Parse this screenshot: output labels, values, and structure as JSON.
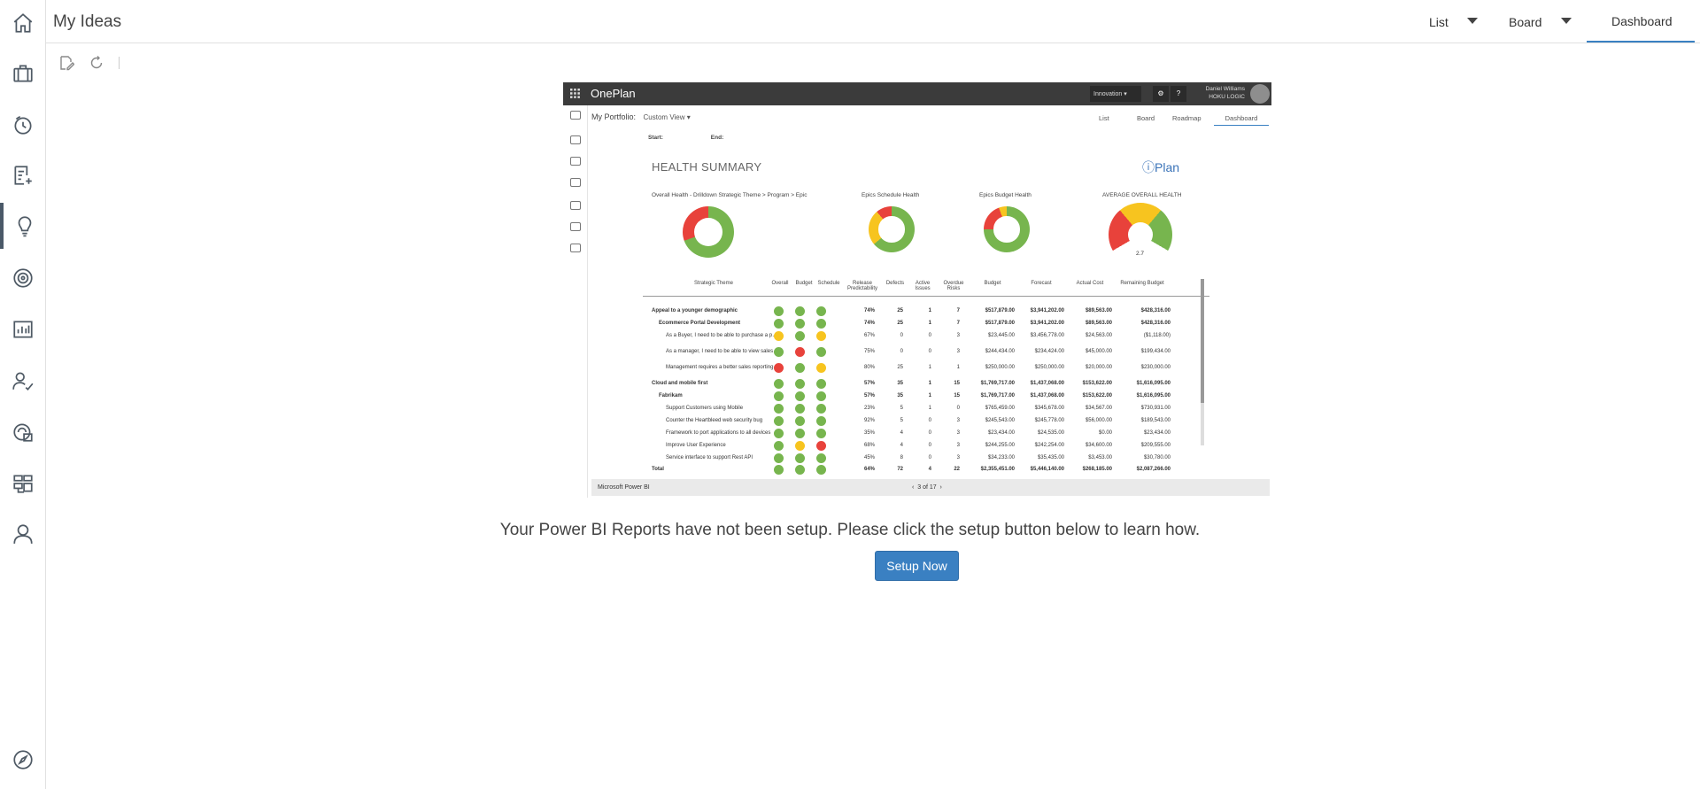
{
  "header": {
    "page_title": "My Ideas",
    "tabs": [
      {
        "label": "List"
      },
      {
        "label": "Board"
      },
      {
        "label": "Dashboard",
        "active": true
      }
    ]
  },
  "sidebar": {
    "items": [
      {
        "icon": "home-icon"
      },
      {
        "icon": "briefcase-icon"
      },
      {
        "icon": "clock-history-icon"
      },
      {
        "icon": "add-list-icon"
      },
      {
        "icon": "lightbulb-icon",
        "active": true
      },
      {
        "icon": "target-icon"
      },
      {
        "icon": "report-chart-icon"
      },
      {
        "icon": "user-check-icon"
      },
      {
        "icon": "resource-icon"
      },
      {
        "icon": "hierarchy-icon"
      },
      {
        "icon": "person-icon"
      },
      {
        "icon": "compass-icon"
      }
    ]
  },
  "toolbar": {
    "icons": [
      "edit-icon",
      "refresh-icon"
    ]
  },
  "preview": {
    "brand": "OnePlan",
    "innovation": "Innovation ▾",
    "user_name": "Daniel Williams",
    "user_org": "HOKU LOGIC",
    "portfolio_label": "My Portfolio:",
    "custom_view": "Custom View ▾",
    "tabs": [
      "List",
      "Board",
      "Roadmap",
      "Dashboard"
    ],
    "start_label": "Start:",
    "end_label": "End:",
    "report_title": "HEALTH SUMMARY",
    "logo_text": "Plan",
    "charts": [
      "Overall Health - Drilldown Strategic Theme > Program > Epic",
      "Epics Schedule Health",
      "Epics Budget Health",
      "AVERAGE OVERALL HEALTH"
    ],
    "gauge_value": "2.7",
    "columns": [
      "Strategic Theme",
      "Overall",
      "Budget",
      "Schedule",
      "Release Predictability",
      "Defects",
      "Active Issues",
      "Overdue Risks",
      "Budget",
      "Forecast",
      "Actual Cost",
      "Remaining Budget"
    ],
    "rows": [
      {
        "name": "Appeal to a younger demographic",
        "bold": true,
        "indent": 0,
        "s": [
          "g",
          "g",
          "g"
        ],
        "vals": [
          "74%",
          "25",
          "1",
          "7",
          "$517,879.00",
          "$3,941,202.00",
          "$89,563.00",
          "$428,316.00"
        ]
      },
      {
        "name": "Ecommerce Portal Development",
        "bold": true,
        "indent": 1,
        "s": [
          "g",
          "g",
          "g"
        ],
        "vals": [
          "74%",
          "25",
          "1",
          "7",
          "$517,879.00",
          "$3,941,202.00",
          "$89,563.00",
          "$428,316.00"
        ]
      },
      {
        "name": "As a Buyer, I need to be able to purchase a product with Pay Pal",
        "bold": false,
        "indent": 2,
        "s": [
          "y",
          "g",
          "y"
        ],
        "vals": [
          "67%",
          "0",
          "0",
          "3",
          "$23,445.00",
          "$3,456,778.00",
          "$24,563.00",
          "($1,118.00)"
        ]
      },
      {
        "name": "As a manager, I need to be able to view sales reports",
        "bold": false,
        "indent": 2,
        "s": [
          "g",
          "r",
          "g"
        ],
        "vals": [
          "75%",
          "0",
          "0",
          "3",
          "$244,434.00",
          "$234,424.00",
          "$45,000.00",
          "$199,434.00"
        ]
      },
      {
        "name": "Management requires a better sales reporting analysis system",
        "bold": false,
        "indent": 2,
        "s": [
          "r",
          "g",
          "y"
        ],
        "vals": [
          "80%",
          "25",
          "1",
          "1",
          "$250,000.00",
          "$250,000.00",
          "$20,000.00",
          "$230,000.00"
        ]
      },
      {
        "name": "Cloud and mobile first",
        "bold": true,
        "indent": 0,
        "s": [
          "g",
          "g",
          "g"
        ],
        "vals": [
          "57%",
          "35",
          "1",
          "15",
          "$1,769,717.00",
          "$1,437,068.00",
          "$153,622.00",
          "$1,616,095.00"
        ]
      },
      {
        "name": "Fabrikam",
        "bold": true,
        "indent": 1,
        "s": [
          "g",
          "g",
          "g"
        ],
        "vals": [
          "57%",
          "35",
          "1",
          "15",
          "$1,769,717.00",
          "$1,437,068.00",
          "$153,622.00",
          "$1,616,095.00"
        ]
      },
      {
        "name": "Support Customers using Mobile",
        "bold": false,
        "indent": 2,
        "s": [
          "g",
          "g",
          "g"
        ],
        "vals": [
          "23%",
          "5",
          "1",
          "0",
          "$765,459.00",
          "$345,678.00",
          "$34,567.00",
          "$730,931.00"
        ]
      },
      {
        "name": "Counter the Heartbleed web security bug",
        "bold": false,
        "indent": 2,
        "s": [
          "g",
          "g",
          "g"
        ],
        "vals": [
          "92%",
          "5",
          "0",
          "3",
          "$245,543.00",
          "$245,778.00",
          "$56,000.00",
          "$189,543.00"
        ]
      },
      {
        "name": "Framework to port applications to all devices",
        "bold": false,
        "indent": 2,
        "s": [
          "g",
          "g",
          "g"
        ],
        "vals": [
          "35%",
          "4",
          "0",
          "3",
          "$23,434.00",
          "$24,535.00",
          "$0.00",
          "$23,434.00"
        ]
      },
      {
        "name": "Improve User Experience",
        "bold": false,
        "indent": 2,
        "s": [
          "g",
          "y",
          "r"
        ],
        "vals": [
          "68%",
          "4",
          "0",
          "3",
          "$244,255.00",
          "$242,254.00",
          "$34,600.00",
          "$209,555.00"
        ]
      },
      {
        "name": "Service interface to support Rest API",
        "bold": false,
        "indent": 2,
        "s": [
          "g",
          "g",
          "g"
        ],
        "vals": [
          "45%",
          "8",
          "0",
          "3",
          "$34,233.00",
          "$35,435.00",
          "$3,453.00",
          "$30,780.00"
        ]
      },
      {
        "name": "Total",
        "bold": true,
        "indent": 0,
        "s": [
          "g",
          "g",
          "g"
        ],
        "vals": [
          "64%",
          "72",
          "4",
          "22",
          "$2,355,451.00",
          "$5,446,140.00",
          "$268,185.00",
          "$2,087,266.00"
        ]
      }
    ],
    "footer_label": "Microsoft Power BI",
    "page_indicator": "3 of 17"
  },
  "message": "Your Power BI Reports have not been setup. Please click the setup button below to learn how.",
  "setup_button": "Setup Now",
  "colors": {
    "accent": "#3a80c2",
    "green": "#77b54e",
    "yellow": "#f7c41f",
    "red": "#e8423b"
  }
}
